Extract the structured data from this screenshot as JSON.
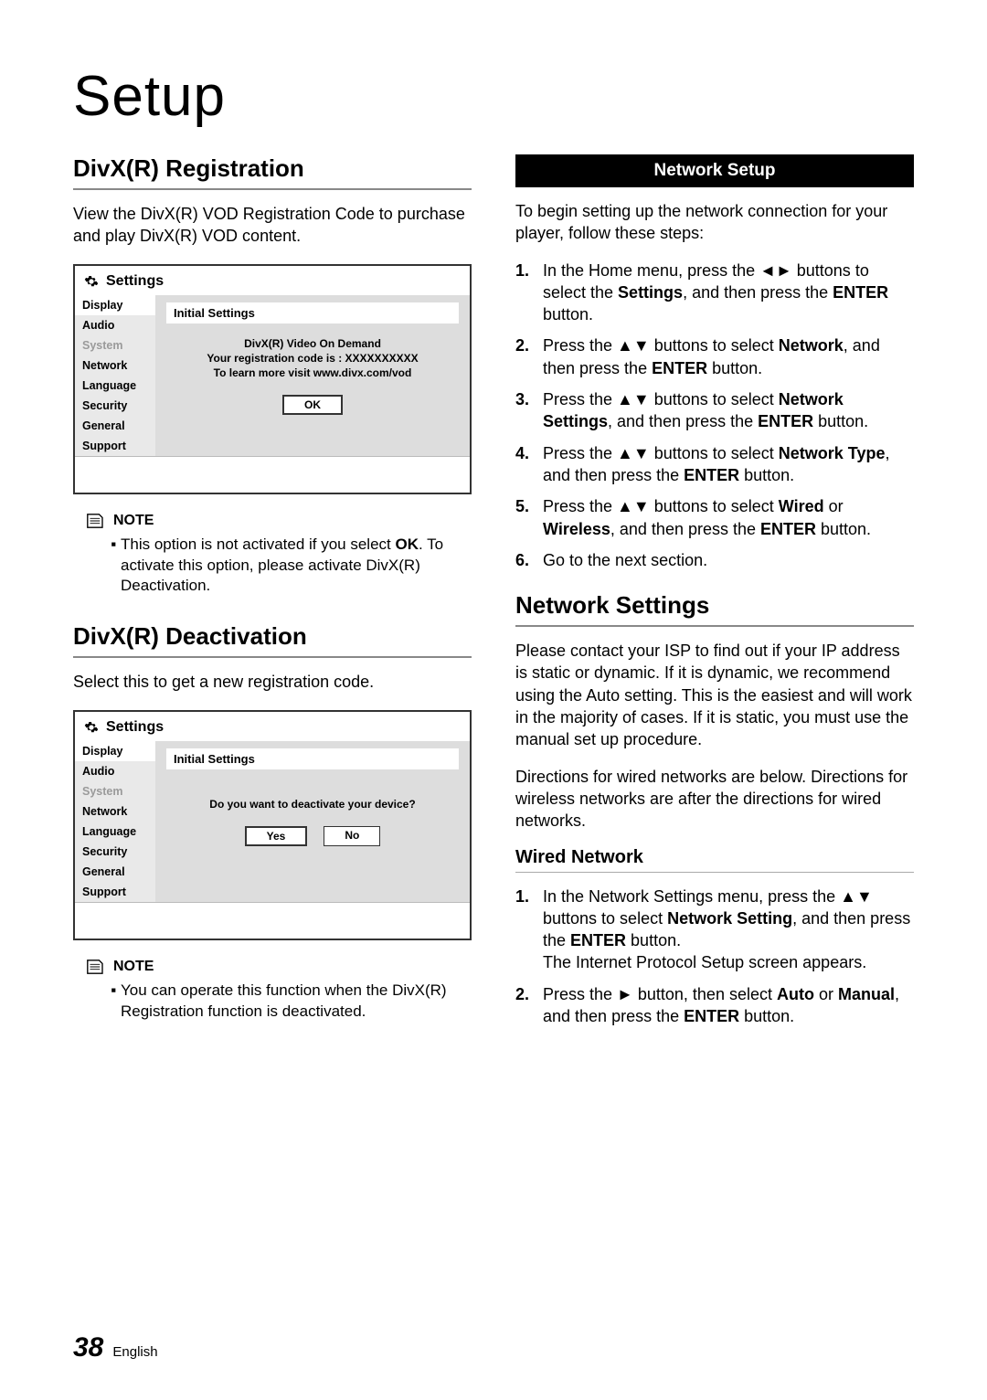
{
  "page_title": "Setup",
  "footer": {
    "num": "38",
    "lang": "English"
  },
  "left": {
    "divx_reg": {
      "heading": "DivX(R) Registration",
      "desc": "View the DivX(R) VOD Registration Code to purchase and play DivX(R) VOD content.",
      "panel": {
        "title": "Settings",
        "menu": [
          "Display",
          "Audio",
          "System",
          "Network",
          "Language",
          "Security",
          "General",
          "Support"
        ],
        "inactive_idx": 2,
        "content_header": "Initial Settings",
        "line1": "DivX(R) Video On Demand",
        "line2": "Your registration code is : XXXXXXXXXX",
        "line3": "To learn more visit www.divx.com/vod",
        "buttons": [
          "OK"
        ]
      },
      "note_label": "NOTE",
      "note_pre": "This option is not activated if you select ",
      "note_bold": "OK",
      "note_post": ". To activate this option, please activate DivX(R) Deactivation."
    },
    "divx_deact": {
      "heading": "DivX(R) Deactivation",
      "desc": "Select this to get a new registration code.",
      "panel": {
        "title": "Settings",
        "menu": [
          "Display",
          "Audio",
          "System",
          "Network",
          "Language",
          "Security",
          "General",
          "Support"
        ],
        "inactive_idx": 2,
        "content_header": "Initial Settings",
        "question": "Do you want to deactivate your device?",
        "buttons": [
          "Yes",
          "No"
        ]
      },
      "note_label": "NOTE",
      "note_text": "You can operate this function when the DivX(R) Registration function is deactivated."
    }
  },
  "right": {
    "netsetup_bar": "Network Setup",
    "netsetup_intro": "To begin setting up the network connection for your player, follow these steps:",
    "steps": [
      {
        "pre": "In the Home menu, press the ",
        "arrows": "◄►",
        "mid": " buttons to select the ",
        "b1": "Settings",
        "mid2": ", and then press the ",
        "b2": "ENTER",
        "post": " button."
      },
      {
        "pre": "Press the ",
        "arrows": "▲▼",
        "mid": " buttons to select ",
        "b1": "Network",
        "mid2": ", and then press the ",
        "b2": "ENTER",
        "post": " button."
      },
      {
        "pre": "Press the ",
        "arrows": "▲▼",
        "mid": " buttons to select ",
        "b1": "Network Settings",
        "mid2": ", and then press the ",
        "b2": "ENTER",
        "post": " button."
      },
      {
        "pre": "Press the ",
        "arrows": "▲▼",
        "mid": " buttons to select ",
        "b1": "Network Type",
        "mid2": ", and then press the ",
        "b2": "ENTER",
        "post": " button."
      },
      {
        "pre": "Press the ",
        "arrows": "▲▼",
        "mid": " buttons to select ",
        "b1": "Wired",
        "or": " or ",
        "b1b": "Wireless",
        "mid2": ", and then press the ",
        "b2": "ENTER",
        "post": " button."
      },
      {
        "plain": "Go to the next section."
      }
    ],
    "netset_heading": "Network Settings",
    "netset_p1": "Please contact your ISP to find out if your IP address is static or dynamic. If it is dynamic, we recommend using the Auto setting. This is the easiest and will work in the majority of cases. If it is static, you must use the manual set up procedure.",
    "netset_p2": "Directions for wired networks are below. Directions for wireless networks are after the directions for wired networks.",
    "wired_heading": "Wired Network",
    "wired_steps": [
      {
        "pre": "In the Network Settings menu, press the ",
        "arrows": "▲▼",
        "mid": " buttons to select ",
        "b1": "Network Setting",
        "mid2": ", and then press the ",
        "b2": "ENTER",
        "post": " button.",
        "extra": "The Internet Protocol Setup screen appears."
      },
      {
        "pre": "Press the ",
        "arrows": "►",
        "mid": " button, then select ",
        "b1": "Auto",
        "or": " or ",
        "b1b": "Manual",
        "mid2": ", and then press the ",
        "b2": "ENTER",
        "post": " button."
      }
    ]
  }
}
